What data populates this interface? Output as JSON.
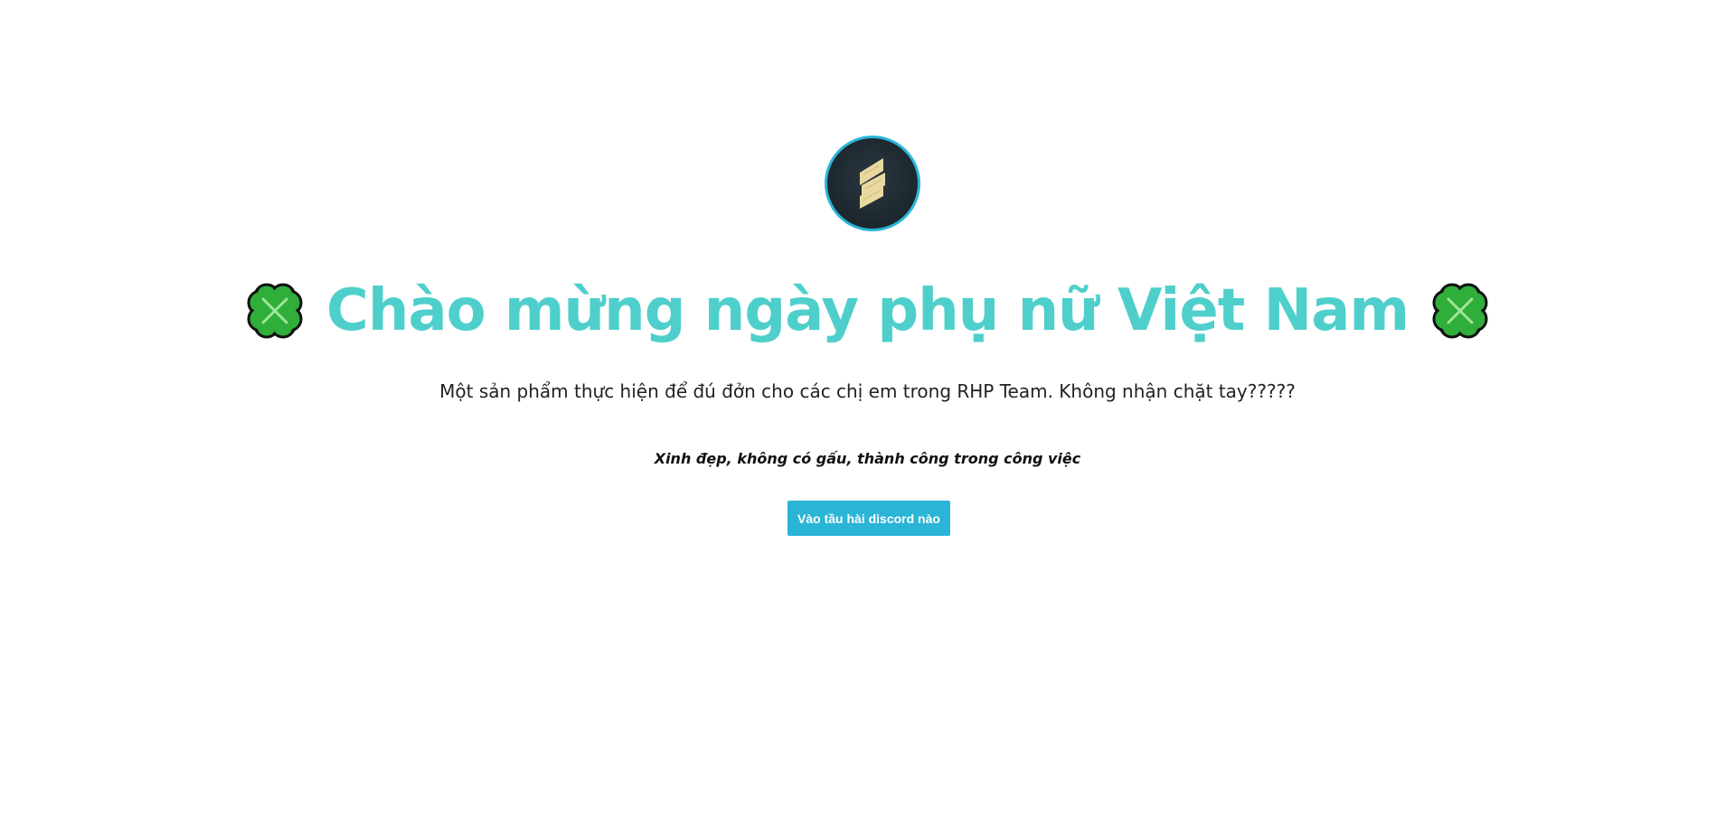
{
  "logo": {
    "icon": "s-logo-icon",
    "border_color": "#29b6d8",
    "logo_color": "#e9d8a0"
  },
  "hero": {
    "title": "Chào mừng ngày phụ nữ Việt Nam",
    "title_color": "#4fcfcb",
    "left_icon": "four-leaf-clover-icon",
    "right_icon": "four-leaf-clover-icon"
  },
  "subtitle": "Một sản phẩm thực hiện để đú đởn cho các chị em trong RHP Team. Không nhận chặt tay?????",
  "tagline": "Xinh đẹp, không có gấu, thành công trong công việc",
  "cta": {
    "label": "Vào tầu hài discord nào",
    "color": "#2ab4d6"
  }
}
